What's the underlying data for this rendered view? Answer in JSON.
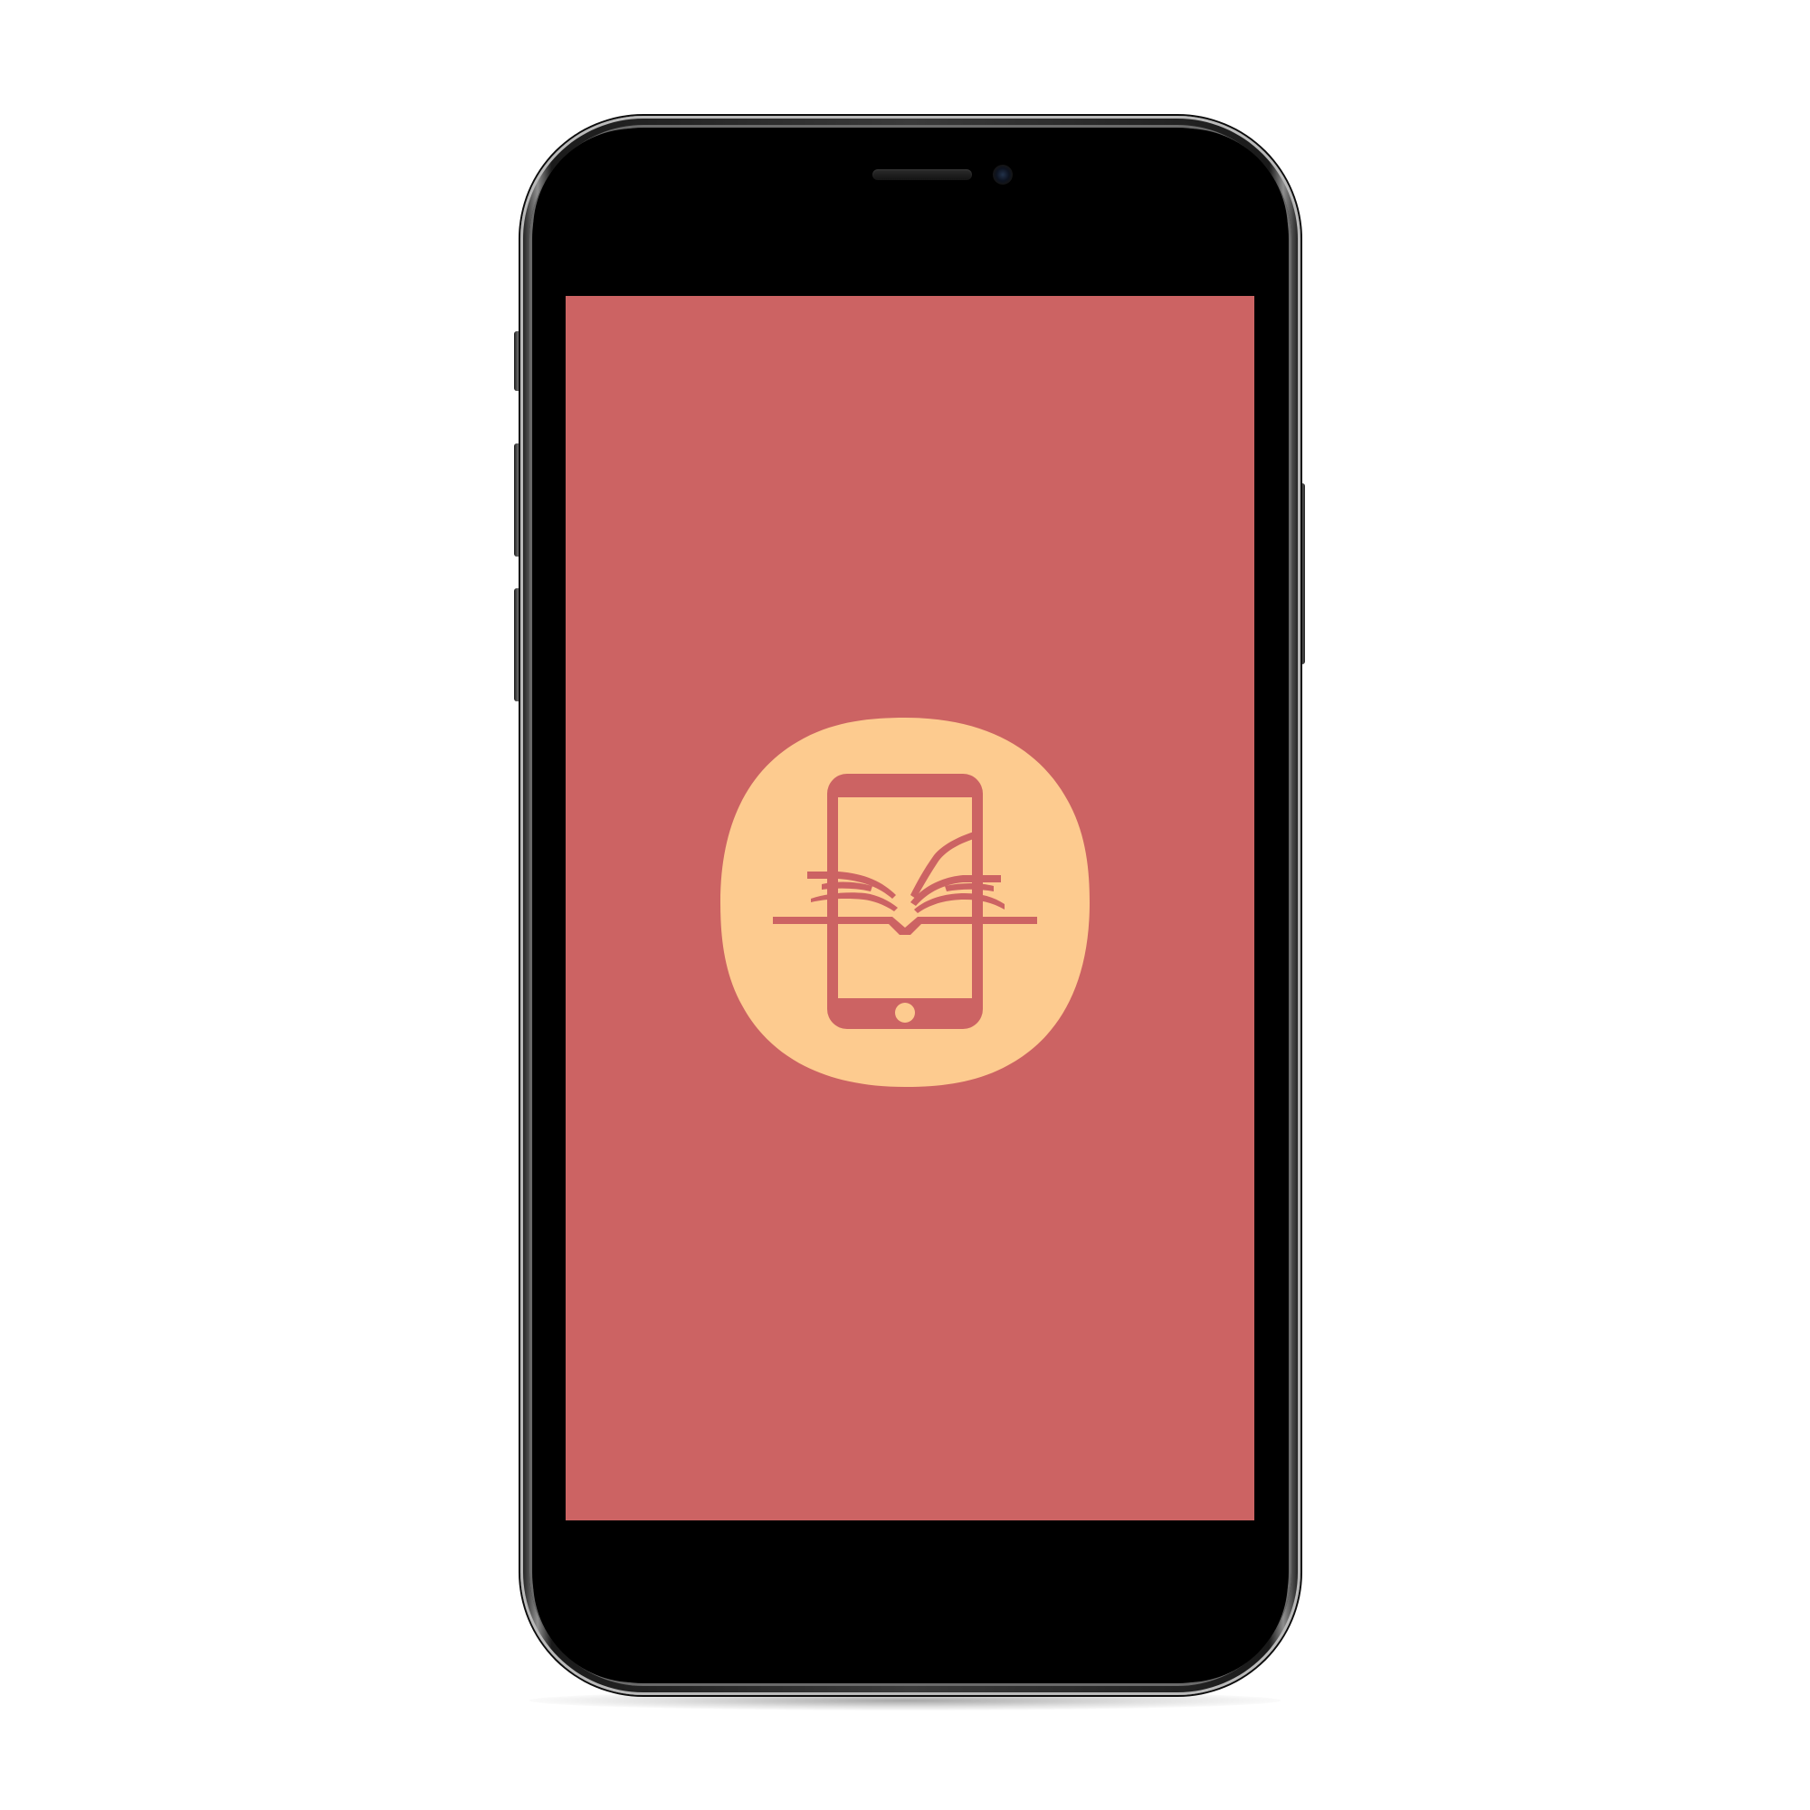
{
  "screen": {
    "background_color": "#cc6363",
    "logo": {
      "icon": "mobile-book-icon",
      "badge_color": "#fdcb8f",
      "glyph_color": "#cc6363"
    }
  },
  "device": {
    "frame_color": "#1a1a1a",
    "bezel_color": "#000000"
  }
}
